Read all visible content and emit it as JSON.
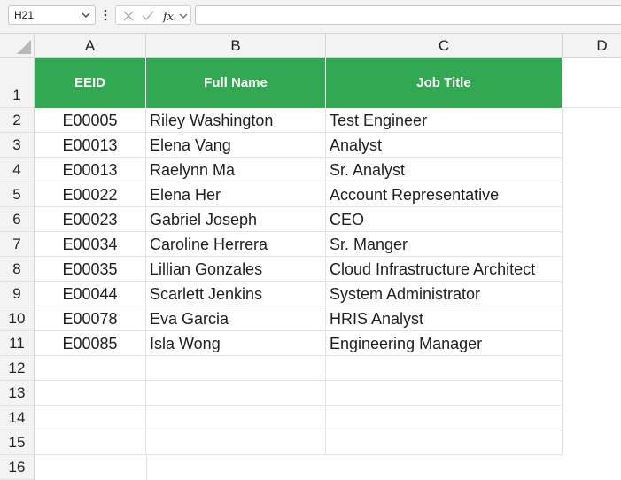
{
  "formula_bar": {
    "name_box": "H21",
    "formula": ""
  },
  "columns": [
    "A",
    "B",
    "C",
    "D"
  ],
  "rows": [
    "1",
    "2",
    "3",
    "4",
    "5",
    "6",
    "7",
    "8",
    "9",
    "10",
    "11",
    "12",
    "13",
    "14",
    "15",
    "16"
  ],
  "table": {
    "header_color": "#32a852",
    "headers": [
      "EEID",
      "Full Name",
      "Job Title"
    ],
    "data": [
      [
        "E00005",
        "Riley Washington",
        "Test Engineer"
      ],
      [
        "E00013",
        "Elena Vang",
        "Analyst"
      ],
      [
        "E00013",
        "Raelynn Ma",
        "Sr. Analyst"
      ],
      [
        "E00022",
        "Elena Her",
        "Account Representative"
      ],
      [
        "E00023",
        "Gabriel Joseph",
        "CEO"
      ],
      [
        "E00034",
        "Caroline Herrera",
        "Sr. Manger"
      ],
      [
        "E00035",
        "Lillian Gonzales",
        "Cloud Infrastructure Architect"
      ],
      [
        "E00044",
        "Scarlett Jenkins",
        "System Administrator"
      ],
      [
        "E00078",
        "Eva Garcia",
        "HRIS Analyst"
      ],
      [
        "E00085",
        "Isla Wong",
        "Engineering Manager"
      ]
    ]
  }
}
